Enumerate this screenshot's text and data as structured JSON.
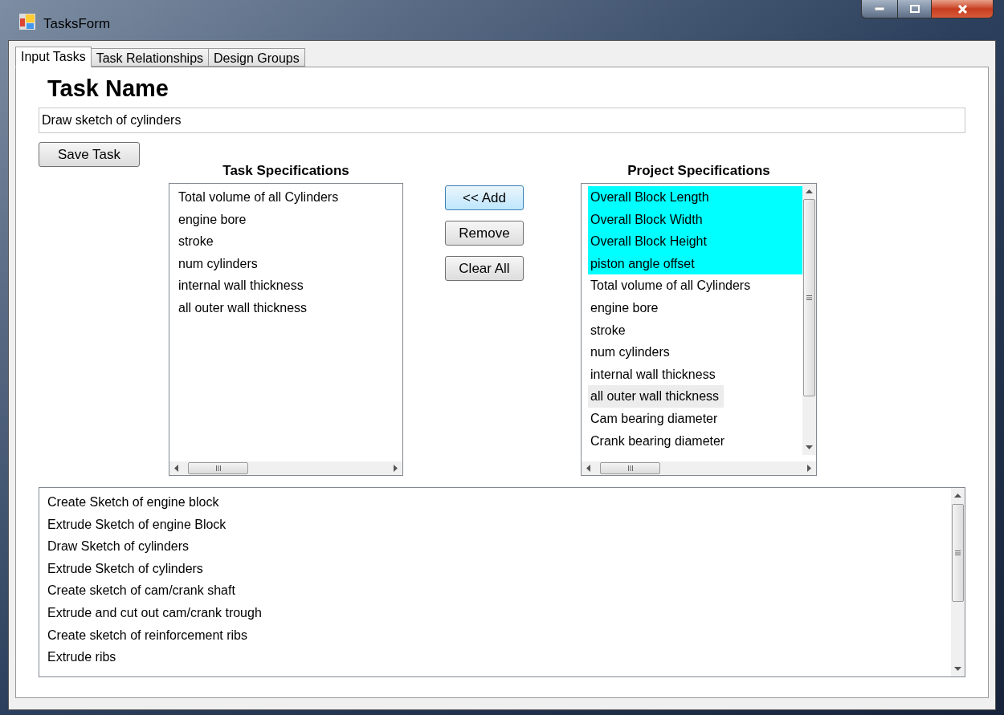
{
  "window": {
    "title": "TasksForm"
  },
  "tabs": [
    {
      "label": "Input Tasks",
      "selected": true
    },
    {
      "label": "Task Relationships",
      "selected": false
    },
    {
      "label": "Design Groups",
      "selected": false
    }
  ],
  "task_name": {
    "heading": "Task Name",
    "value": "Draw sketch of cylinders"
  },
  "save_button": "Save Task",
  "task_specifications": {
    "heading": "Task Specifications",
    "items": [
      {
        "label": "Total volume of all Cylinders",
        "selected": false,
        "highlighted": false
      },
      {
        "label": "engine bore",
        "selected": false,
        "highlighted": false
      },
      {
        "label": "stroke",
        "selected": false,
        "highlighted": false
      },
      {
        "label": "num cylinders",
        "selected": false,
        "highlighted": false
      },
      {
        "label": "internal wall thickness",
        "selected": false,
        "highlighted": false
      },
      {
        "label": "all outer wall thickness",
        "selected": false,
        "highlighted": false
      }
    ]
  },
  "action_buttons": [
    "<< Add",
    "Remove",
    "Clear All"
  ],
  "project_specifications": {
    "heading": "Project Specifications",
    "items": [
      {
        "label": "Overall Block Length",
        "selected": true,
        "highlighted": false
      },
      {
        "label": "Overall Block Width",
        "selected": true,
        "highlighted": false
      },
      {
        "label": "Overall Block Height",
        "selected": true,
        "highlighted": false
      },
      {
        "label": "piston angle offset",
        "selected": true,
        "highlighted": false
      },
      {
        "label": "Total volume of all Cylinders",
        "selected": false,
        "highlighted": false
      },
      {
        "label": "engine bore",
        "selected": false,
        "highlighted": false
      },
      {
        "label": "stroke",
        "selected": false,
        "highlighted": false
      },
      {
        "label": "num cylinders",
        "selected": false,
        "highlighted": false
      },
      {
        "label": "internal wall thickness",
        "selected": false,
        "highlighted": false
      },
      {
        "label": "all outer wall thickness",
        "selected": false,
        "highlighted": true
      },
      {
        "label": "Cam bearing diameter",
        "selected": false,
        "highlighted": false
      },
      {
        "label": "Crank bearing diameter",
        "selected": false,
        "highlighted": false
      }
    ]
  },
  "task_list": {
    "items": [
      {
        "label": "Create Sketch of engine block",
        "selected": false
      },
      {
        "label": "Extrude Sketch of engine Block",
        "selected": false
      },
      {
        "label": "Draw Sketch of cylinders",
        "selected": false
      },
      {
        "label": "Extrude Sketch of cylinders",
        "selected": false
      },
      {
        "label": "Create sketch of cam/crank shaft",
        "selected": false
      },
      {
        "label": "Extrude and cut out cam/crank trough",
        "selected": false
      },
      {
        "label": "Create sketch of reinforcement ribs",
        "selected": false
      },
      {
        "label": "Extrude ribs",
        "selected": false
      }
    ]
  }
}
